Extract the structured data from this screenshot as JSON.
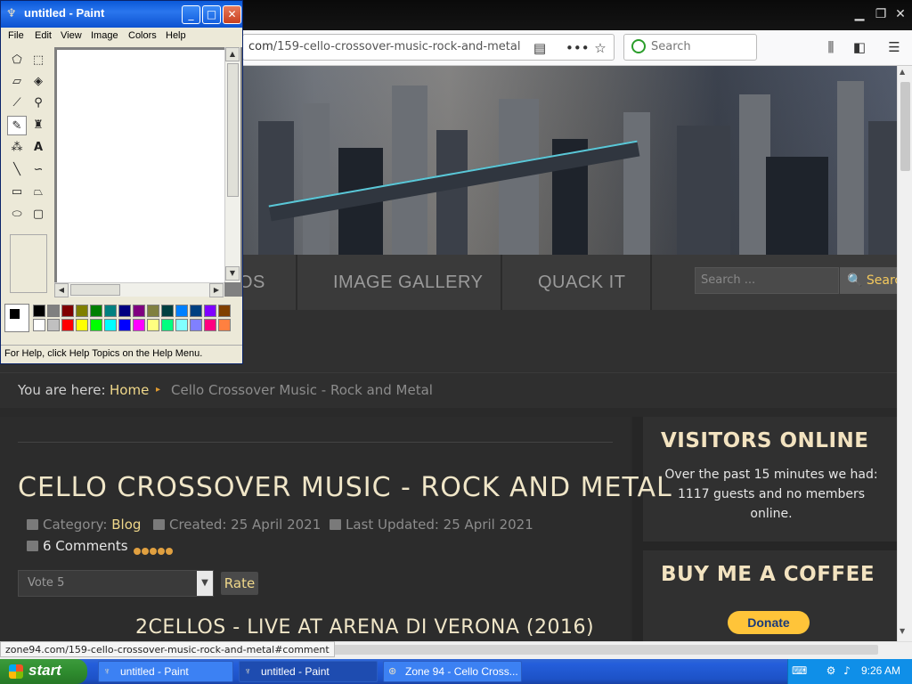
{
  "browser": {
    "url_host": "com",
    "url_path": "/159-cello-crossover-music-rock-and-metal",
    "search_placeholder": "Search",
    "status_link": "zone94.com/159-cello-crossover-music-rock-and-metal#comment"
  },
  "site": {
    "nav": [
      "OS",
      "IMAGE GALLERY",
      "QUACK IT"
    ],
    "search_placeholder": "Search ...",
    "search_button": "Search",
    "breadcrumb": {
      "prefix": "You are here:",
      "home": "Home",
      "separator": "▸",
      "current": "Cello Crossover Music - Rock and Metal"
    },
    "article": {
      "title": "CELLO CROSSOVER MUSIC - ROCK AND METAL",
      "category_label": "Category:",
      "category": "Blog",
      "created": "Created: 25 April 2021",
      "updated": "Last Updated: 25 April 2021",
      "comments": "6 Comments",
      "vote_value": "Vote 5",
      "rate_button": "Rate",
      "section_heading": "2CELLOS - LIVE AT ARENA DI VERONA (2016)"
    },
    "sidebar": {
      "visitors_title": "VISITORS ONLINE",
      "visitors_text": "Over the past 15 minutes we had: 1117 guests and no members online.",
      "coffee_title": "BUY ME A COFFEE",
      "donate": "Donate"
    }
  },
  "paint": {
    "title": "untitled - Paint",
    "menu": [
      "File",
      "Edit",
      "View",
      "Image",
      "Colors",
      "Help"
    ],
    "status": "For Help, click Help Topics on the Help Menu.",
    "palette_top": [
      "#000000",
      "#808080",
      "#800000",
      "#808000",
      "#008000",
      "#008080",
      "#000080",
      "#800080",
      "#808040",
      "#004040",
      "#0080ff",
      "#004080",
      "#8000ff",
      "#804000"
    ],
    "palette_bottom": [
      "#ffffff",
      "#c0c0c0",
      "#ff0000",
      "#ffff00",
      "#00ff00",
      "#00ffff",
      "#0000ff",
      "#ff00ff",
      "#ffff80",
      "#00ff80",
      "#80ffff",
      "#8080ff",
      "#ff0080",
      "#ff8040"
    ]
  },
  "taskbar": {
    "start": "start",
    "tasks": [
      "untitled - Paint",
      "untitled - Paint",
      "Zone 94 - Cello Cross..."
    ],
    "clock": "9:26 AM"
  }
}
